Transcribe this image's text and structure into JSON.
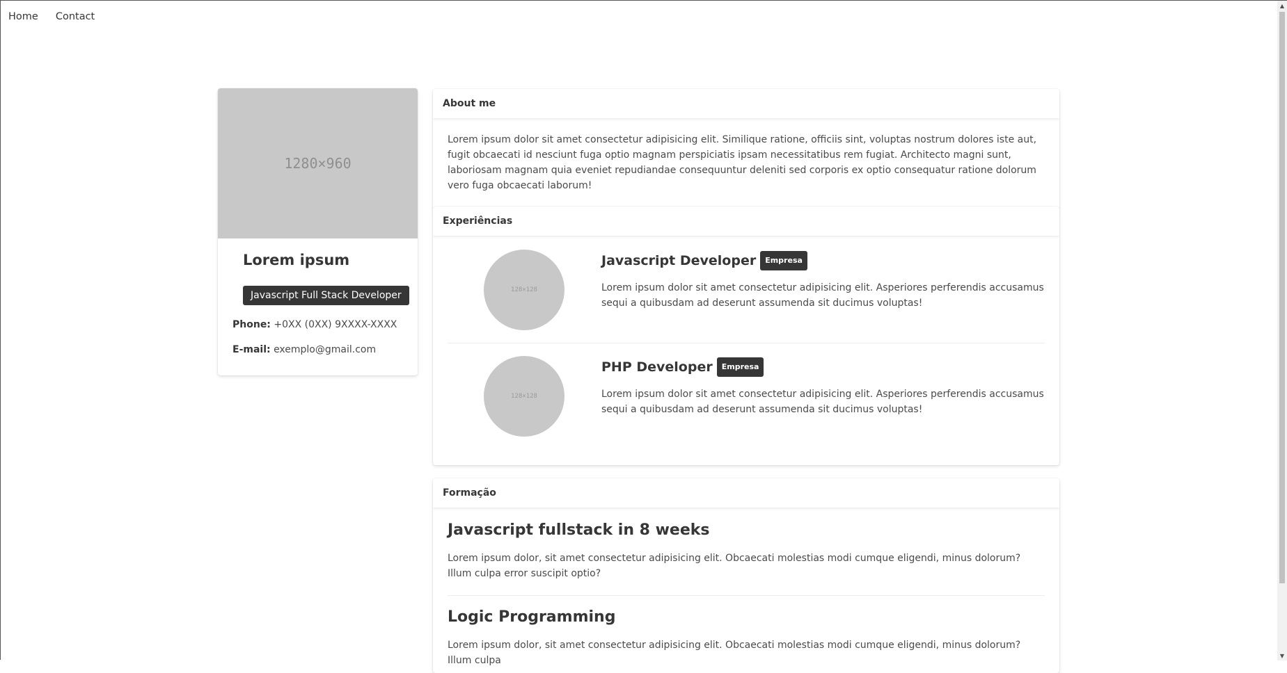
{
  "nav": {
    "home": "Home",
    "contact": "Contact"
  },
  "profile": {
    "image_label": "1280×960",
    "name": "Lorem ipsum",
    "role": "Javascript Full Stack Developer",
    "phone_label": "Phone:",
    "phone": "+0XX (0XX) 9XXXX-XXXX",
    "email_label": "E-mail:",
    "email": "exemplo@gmail.com"
  },
  "about": {
    "title": "About me",
    "text": "Lorem ipsum dolor sit amet consectetur adipisicing elit. Similique ratione, officiis sint, voluptas nostrum dolores iste aut, fugit obcaecati id nesciunt fuga optio magnam perspiciatis ipsam necessitatibus rem fugiat. Architecto magni sunt, laboriosam magnam quia eveniet repudiandae consequuntur deleniti sed corporis ex optio consequatur ratione dolorum vero fuga obcaecati laborum!"
  },
  "experiences": {
    "title": "Experiências",
    "items": [
      {
        "avatar_label": "128×128",
        "title": "Javascript Developer",
        "company": "Empresa",
        "text": "Lorem ipsum dolor sit amet consectetur adipisicing elit. Asperiores perferendis accusamus sequi a quibusdam ad deserunt assumenda sit ducimus voluptas!"
      },
      {
        "avatar_label": "128×128",
        "title": "PHP Developer",
        "company": "Empresa",
        "text": "Lorem ipsum dolor sit amet consectetur adipisicing elit. Asperiores perferendis accusamus sequi a quibusdam ad deserunt assumenda sit ducimus voluptas!"
      }
    ]
  },
  "education": {
    "title": "Formação",
    "items": [
      {
        "title": "Javascript fullstack in 8 weeks",
        "text": "Lorem ipsum dolor, sit amet consectetur adipisicing elit. Obcaecati molestias modi cumque eligendi, minus dolorum? Illum culpa error suscipit optio?"
      },
      {
        "title": "Logic Programming",
        "text": "Lorem ipsum dolor, sit amet consectetur adipisicing elit. Obcaecati molestias modi cumque eligendi, minus dolorum? Illum culpa"
      }
    ]
  }
}
